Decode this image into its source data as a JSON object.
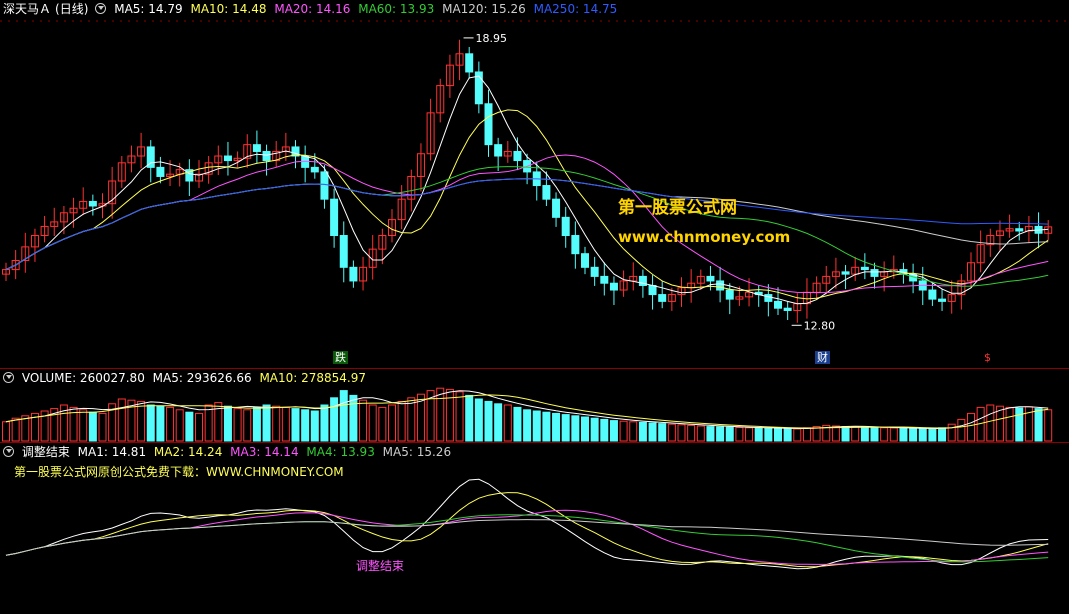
{
  "main": {
    "stock_name": "深天马Ａ",
    "period": "(日线)",
    "ma5": "MA5: 14.79",
    "ma10": "MA10: 14.48",
    "ma20": "MA20: 14.16",
    "ma60": "MA60: 13.93",
    "ma120": "MA120: 15.26",
    "ma250": "MA250: 14.75",
    "high_label": "18.95",
    "low_label": "12.80",
    "tag_die": "跌",
    "tag_cai": "财",
    "tag_s": "$",
    "watermark_cn": "第一股票公式网",
    "watermark_url": "www.chnmoney.com"
  },
  "volume": {
    "title": "VOLUME: 260027.80",
    "ma5": "MA5: 293626.66",
    "ma10": "MA10: 278854.97"
  },
  "indicator": {
    "title": "调整结束",
    "ma1": "MA1: 14.81",
    "ma2": "MA2: 14.24",
    "ma3": "MA3: 14.14",
    "ma4": "MA4: 13.93",
    "ma5": "MA5: 15.26",
    "promo": "第一股票公式网原创公式免费下载：WWW.CHNMONEY.COM",
    "signal_label": "调整结束"
  },
  "colors": {
    "up": "#ff3333",
    "down": "#54fcfc",
    "ma5": "#ffffff",
    "ma10": "#ffff55",
    "ma20": "#ff55ff",
    "ma60": "#33cc33",
    "ma120": "#cccccc",
    "ma250": "#2d5bff",
    "sep": "#8b0000"
  },
  "chart_data": {
    "type": "candlestick",
    "price_range": [
      12.3,
      19.3
    ],
    "high": 18.95,
    "low": 12.8,
    "closes": [
      13.85,
      14.05,
      14.35,
      14.6,
      14.8,
      14.9,
      15.1,
      15.2,
      15.35,
      15.25,
      15.3,
      15.8,
      16.2,
      16.35,
      16.55,
      16.1,
      15.9,
      15.95,
      16.05,
      15.8,
      15.95,
      16.2,
      16.35,
      16.25,
      16.3,
      16.6,
      16.45,
      16.25,
      16.45,
      16.55,
      16.35,
      16.1,
      16.0,
      15.4,
      14.6,
      13.9,
      13.6,
      13.9,
      14.3,
      14.6,
      14.95,
      15.4,
      15.9,
      16.4,
      17.3,
      17.9,
      18.35,
      18.6,
      18.2,
      17.5,
      16.6,
      16.35,
      16.45,
      16.25,
      16.0,
      15.7,
      15.4,
      15.0,
      14.6,
      14.2,
      13.9,
      13.7,
      13.55,
      13.4,
      13.6,
      13.7,
      13.5,
      13.3,
      13.15,
      13.3,
      13.45,
      13.55,
      13.7,
      13.6,
      13.4,
      13.2,
      13.25,
      13.35,
      13.3,
      13.15,
      13.0,
      12.95,
      13.1,
      13.35,
      13.55,
      13.7,
      13.8,
      13.75,
      13.9,
      13.85,
      13.7,
      13.8,
      13.85,
      13.75,
      13.6,
      13.4,
      13.2,
      13.15,
      13.3,
      13.6,
      14.0,
      14.4,
      14.6,
      14.7,
      14.75,
      14.7,
      14.8,
      14.65,
      14.79
    ],
    "volume_range": [
      0,
      450000
    ],
    "volumes": [
      160000,
      190000,
      210000,
      230000,
      250000,
      270000,
      300000,
      280000,
      260000,
      240000,
      230000,
      310000,
      350000,
      340000,
      330000,
      300000,
      290000,
      280000,
      260000,
      240000,
      230000,
      300000,
      320000,
      290000,
      270000,
      260000,
      280000,
      300000,
      290000,
      280000,
      270000,
      260000,
      250000,
      300000,
      360000,
      420000,
      380000,
      340000,
      300000,
      280000,
      300000,
      330000,
      360000,
      390000,
      420000,
      440000,
      430000,
      410000,
      380000,
      350000,
      330000,
      310000,
      300000,
      280000,
      260000,
      250000,
      240000,
      230000,
      220000,
      210000,
      200000,
      190000,
      180000,
      170000,
      165000,
      160000,
      155000,
      150000,
      145000,
      140000,
      135000,
      130000,
      125000,
      120000,
      118000,
      115000,
      112000,
      110000,
      108000,
      106000,
      104000,
      102000,
      100000,
      110000,
      120000,
      130000,
      125000,
      120000,
      118000,
      115000,
      112000,
      110000,
      108000,
      106000,
      104000,
      102000,
      100000,
      110000,
      140000,
      180000,
      230000,
      280000,
      300000,
      290000,
      280000,
      275000,
      285000,
      270000,
      260027
    ],
    "vol_ma5": 293626.66,
    "vol_ma10": 278854.97
  }
}
